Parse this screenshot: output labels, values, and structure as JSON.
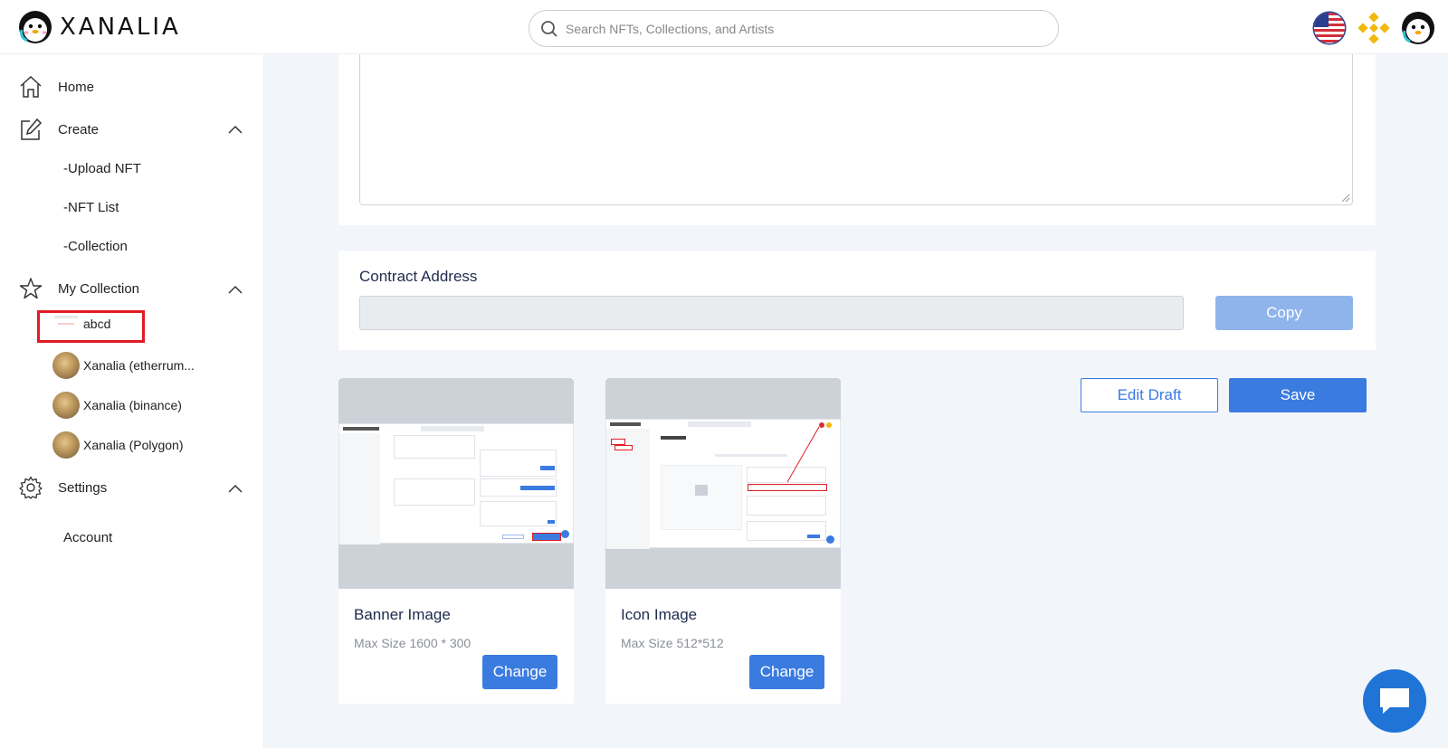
{
  "header": {
    "logo_text": "XANALIA",
    "search_placeholder": "Search NFTs, Collections, and Artists",
    "icons": [
      "us-flag-icon",
      "binance-icon",
      "avatar-icon"
    ]
  },
  "sidebar": {
    "home": "Home",
    "create": "Create",
    "create_items": [
      "-Upload NFT",
      "-NFT List",
      "-Collection"
    ],
    "my_collection": "My Collection",
    "collections": [
      "abcd",
      "Xanalia (etherrum...",
      "Xanalia (binance)",
      "Xanalia (Polygon)"
    ],
    "settings": "Settings",
    "settings_items": [
      "Account"
    ]
  },
  "main": {
    "contract_label": "Contract Address",
    "contract_value": "",
    "copy_label": "Copy",
    "edit_draft_label": "Edit Draft",
    "save_label": "Save",
    "banner": {
      "title": "Banner Image",
      "sub": "Max Size 1600 * 300",
      "change": "Change"
    },
    "icon": {
      "title": "Icon Image",
      "sub": "Max Size 512*512",
      "change": "Change"
    }
  },
  "colors": {
    "primary": "#3a7be0",
    "copy_disabled": "#8fb4ec",
    "highlight": "#e01b24",
    "background": "#f2f5fa"
  }
}
